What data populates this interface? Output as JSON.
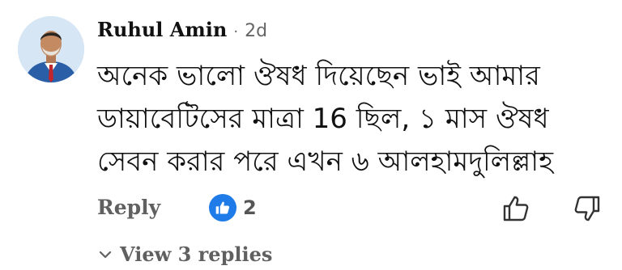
{
  "comment": {
    "author": "Ruhul Amin",
    "separator": "·",
    "time": "2d",
    "lines": [
      "অনেক ভালো ঔষধ দিয়েছেন ভাই আমার",
      "ডায়াবেটিসের মাত্রা 16 ছিল,  ১ মাস ঔষধ",
      "সেবন করার পরে এখন ৬ আলহামদুলিল্লাহ"
    ],
    "reply_label": "Reply",
    "like_count": "2",
    "view_replies_label": "View 3 replies"
  },
  "icons": {
    "avatar": "avatar",
    "like": "like-reaction-icon",
    "thumb_up": "thumb-up-icon",
    "thumb_down": "thumb-down-icon",
    "chevron": "chevron-down-icon"
  },
  "colors": {
    "like_blue": "#1f7be8",
    "secondary_text": "#606060",
    "primary_text": "#111111"
  }
}
